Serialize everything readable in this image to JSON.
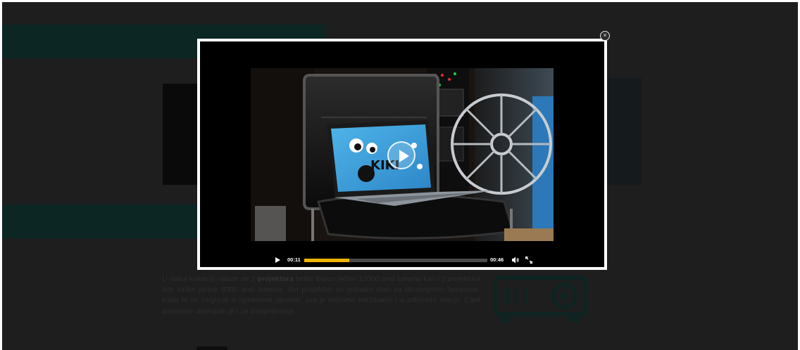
{
  "background": {
    "paragraph": [
      {
        "text": "U našoj kolekciji nalaze se 2 ",
        "bold": false
      },
      {
        "text": "projektora",
        "bold": true
      },
      {
        "text": " tvrtke Barco jačine 12000 ansi lumena kao i 2 projektora iste tvrtke jačine 6000 ansi lumena. Svi projektori su jednako stari sa obnovljenim lampama. Kako bi se osigurali u ispravnost opreme, sva je redovno održavano i u odličnom stanju. Cijeli asortiman dostupan je i za iznajmljivanje.",
        "bold": false
      }
    ],
    "icon": "projector-icon"
  },
  "modal": {
    "close_symbol": "×",
    "close_icon": "close-icon"
  },
  "video": {
    "screen_text": "KIKI",
    "current_time": "00:11",
    "duration": "00:46",
    "progress": 0.245,
    "accent_color": "#f0b400",
    "icons": {
      "play": "play-icon",
      "big_play": "play-circle-icon",
      "volume": "volume-icon",
      "fullscreen": "fullscreen-icon"
    }
  }
}
